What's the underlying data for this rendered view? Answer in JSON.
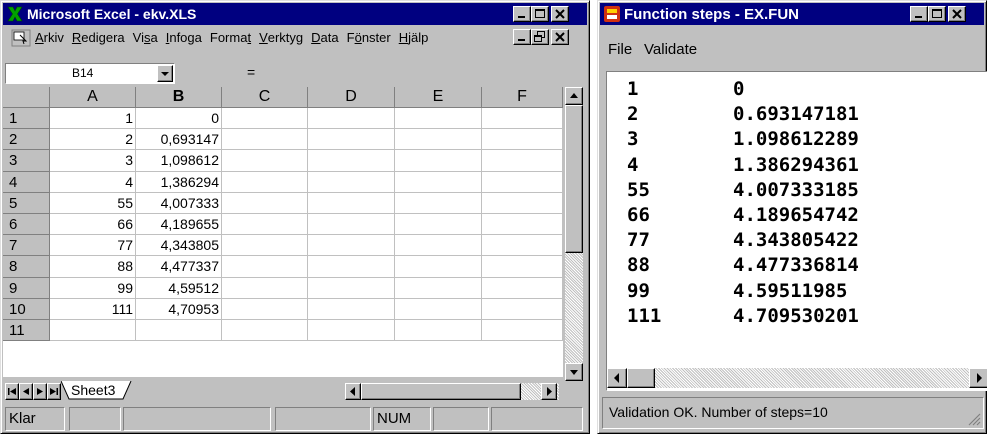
{
  "excel": {
    "title": "Microsoft Excel - ekv.XLS",
    "menu": [
      {
        "pre": "",
        "ul": "A",
        "post": "rkiv"
      },
      {
        "pre": "",
        "ul": "R",
        "post": "edigera"
      },
      {
        "pre": "Vi",
        "ul": "s",
        "post": "a"
      },
      {
        "pre": "",
        "ul": "I",
        "post": "nfoga"
      },
      {
        "pre": "Forma",
        "ul": "t",
        "post": ""
      },
      {
        "pre": "",
        "ul": "V",
        "post": "erktyg"
      },
      {
        "pre": "",
        "ul": "D",
        "post": "ata"
      },
      {
        "pre": "F",
        "ul": "ö",
        "post": "nster"
      },
      {
        "pre": "",
        "ul": "H",
        "post": "jälp"
      }
    ],
    "name_box": "B14",
    "formula_eq": "=",
    "columns": [
      "A",
      "B",
      "C",
      "D",
      "E",
      "F"
    ],
    "rows": [
      {
        "n": "1",
        "a": "1",
        "b": "0"
      },
      {
        "n": "2",
        "a": "2",
        "b": "0,693147"
      },
      {
        "n": "3",
        "a": "3",
        "b": "1,098612"
      },
      {
        "n": "4",
        "a": "4",
        "b": "1,386294"
      },
      {
        "n": "5",
        "a": "55",
        "b": "4,007333"
      },
      {
        "n": "6",
        "a": "66",
        "b": "4,189655"
      },
      {
        "n": "7",
        "a": "77",
        "b": "4,343805"
      },
      {
        "n": "8",
        "a": "88",
        "b": "4,477337"
      },
      {
        "n": "9",
        "a": "99",
        "b": "4,59512"
      },
      {
        "n": "10",
        "a": "111",
        "b": "4,70953"
      },
      {
        "n": "11",
        "a": "",
        "b": ""
      }
    ],
    "sheet_tab": "Sheet3",
    "status": {
      "ready": "Klar",
      "num": "NUM"
    },
    "colors": {
      "title_bg": "#000080",
      "face": "#c0c0c0",
      "icon": "#008000"
    }
  },
  "fun": {
    "title": "Function steps - EX.FUN",
    "menu": [
      "File",
      "Validate"
    ],
    "rows": [
      {
        "step": "1",
        "value": "0"
      },
      {
        "step": "2",
        "value": "0.693147181"
      },
      {
        "step": "3",
        "value": "1.098612289"
      },
      {
        "step": "4",
        "value": "1.386294361"
      },
      {
        "step": "55",
        "value": "4.007333185"
      },
      {
        "step": "66",
        "value": "4.189654742"
      },
      {
        "step": "77",
        "value": "4.343805422"
      },
      {
        "step": "88",
        "value": "4.477336814"
      },
      {
        "step": "99",
        "value": "4.59511985"
      },
      {
        "step": "111",
        "value": "4.709530201"
      }
    ],
    "status": "Validation OK. Number of steps=10"
  }
}
